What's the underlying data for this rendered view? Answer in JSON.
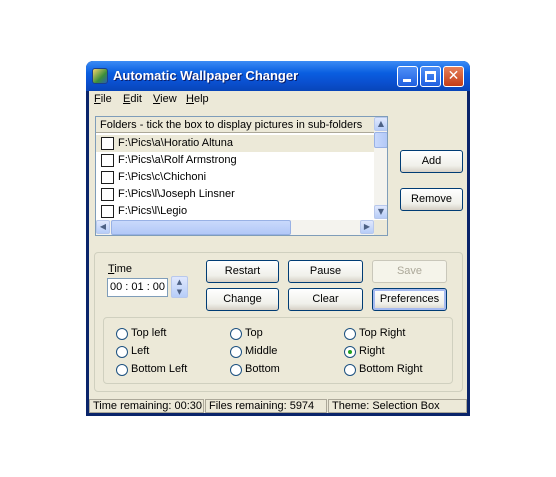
{
  "window": {
    "title": "Automatic Wallpaper Changer",
    "icon": "wallpaper-app-icon",
    "controls": {
      "minimize": "minimize-icon",
      "maximize": "maximize-icon",
      "close": "close-icon",
      "close_glyph": "✕"
    }
  },
  "menu": {
    "items": [
      {
        "label": "File"
      },
      {
        "label": "Edit"
      },
      {
        "label": "View"
      },
      {
        "label": "Help"
      }
    ]
  },
  "folders": {
    "header": "Folders - tick the box to display pictures in sub-folders",
    "items": [
      {
        "path": "F:\\Pics\\a\\Horatio Altuna",
        "checked": false,
        "selected": true
      },
      {
        "path": "F:\\Pics\\a\\Rolf Armstrong",
        "checked": false,
        "selected": false
      },
      {
        "path": "F:\\Pics\\c\\Chichoni",
        "checked": false,
        "selected": false
      },
      {
        "path": "F:\\Pics\\l\\Joseph Linsner",
        "checked": false,
        "selected": false
      },
      {
        "path": "F:\\Pics\\l\\Legio",
        "checked": false,
        "selected": false
      }
    ]
  },
  "side_buttons": {
    "add": "Add",
    "remove": "Remove"
  },
  "timer": {
    "label": "Time",
    "value": "00 : 01 : 00"
  },
  "actions": {
    "restart": "Restart",
    "pause": "Pause",
    "save": "Save",
    "change": "Change",
    "clear": "Clear",
    "preferences": "Preferences"
  },
  "positions": {
    "options": [
      {
        "label": "Top left",
        "selected": false
      },
      {
        "label": "Top",
        "selected": false
      },
      {
        "label": "Top Right",
        "selected": false
      },
      {
        "label": "Left",
        "selected": false
      },
      {
        "label": "Middle",
        "selected": false
      },
      {
        "label": "Right",
        "selected": true
      },
      {
        "label": "Bottom Left",
        "selected": false
      },
      {
        "label": "Bottom",
        "selected": false
      },
      {
        "label": "Bottom Right",
        "selected": false
      }
    ]
  },
  "status": {
    "time_remaining": "Time remaining: 00:30",
    "files_remaining": "Files remaining: 5974",
    "theme": "Theme: Selection Box"
  },
  "colors": {
    "titlebar": "#0a5ee0",
    "client": "#ece9d8",
    "radio_dot": "#21a121"
  }
}
